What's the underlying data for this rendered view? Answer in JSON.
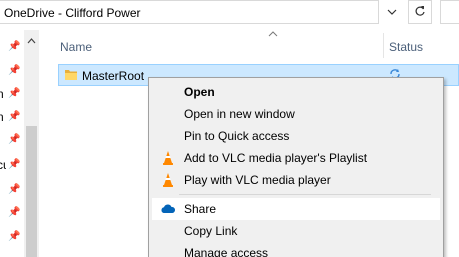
{
  "address_bar": {
    "path": "OneDrive - Clifford Power",
    "dropdown_icon": "chevron-down-icon",
    "refresh_icon": "refresh-icon"
  },
  "nav_pane": {
    "pin_icon": "pin-icon",
    "clipped_labels": [
      "n",
      "n",
      "cu"
    ]
  },
  "columns": {
    "name": "Name",
    "status": "Status",
    "sort_icon": "sort-up-icon"
  },
  "files": [
    {
      "name": "MasterRoot",
      "type": "folder",
      "status_icon": "sync-pending-icon",
      "selected": true
    }
  ],
  "context_menu": {
    "items": [
      {
        "label": "Open",
        "bold": true,
        "icon": ""
      },
      {
        "label": "Open in new window",
        "icon": ""
      },
      {
        "label": "Pin to Quick access",
        "icon": ""
      },
      {
        "label": "Add to VLC media player's Playlist",
        "icon": "vlc-cone-icon"
      },
      {
        "label": "Play with VLC media player",
        "icon": "vlc-cone-icon"
      },
      {
        "label": "Share",
        "icon": "onedrive-cloud-icon",
        "highlighted": true
      },
      {
        "label": "Copy Link",
        "icon": ""
      },
      {
        "label": "Manage access",
        "icon": ""
      }
    ]
  },
  "colors": {
    "selection_bg": "#cce8ff",
    "selection_border": "#99d1ff",
    "menu_bg": "#f0f0f0",
    "onedrive_blue": "#0364b8",
    "vlc_orange": "#ff8800",
    "header_text": "#4c607a"
  }
}
